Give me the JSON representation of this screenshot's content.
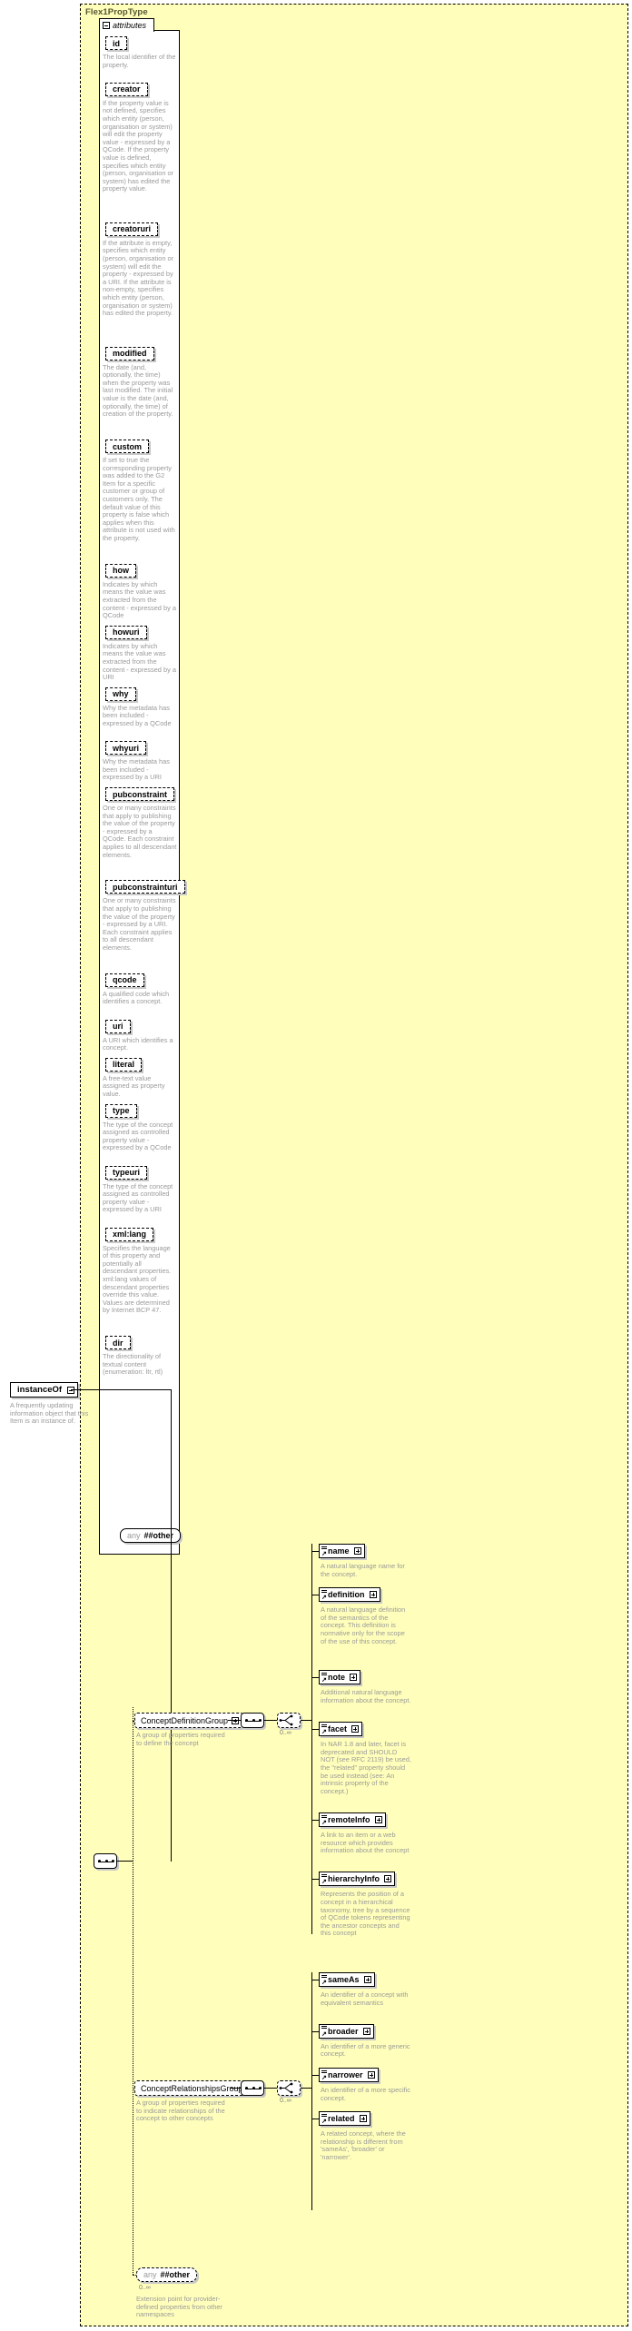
{
  "diagram": {
    "type_name": "Flex1PropType",
    "attributes_label": "attributes",
    "root_element": {
      "name": "instanceOf",
      "description": "A frequently updating information object that this Item is an instance of."
    },
    "attributes": [
      {
        "name": "id",
        "description": "The local identifier of the property."
      },
      {
        "name": "creator",
        "description": "If the property value is not defined, specifies which entity (person, organisation or system) will edit the property value - expressed by a QCode. If the property value is defined, specifies which entity (person, organisation or system) has edited the property value."
      },
      {
        "name": "creatoruri",
        "description": "If the attribute is empty, specifies which entity (person, organisation or system) will edit the property - expressed by a URI. If the attribute is non-empty, specifies which entity (person, organisation or system) has edited the property."
      },
      {
        "name": "modified",
        "description": "The date (and, optionally, the time) when the property was last modified. The initial value is the date (and, optionally, the time) of creation of the property."
      },
      {
        "name": "custom",
        "description": "If set to true the corresponding property was added to the G2 Item for a specific customer or group of customers only. The default value of this property is false which applies when this attribute is not used with the property."
      },
      {
        "name": "how",
        "description": "Indicates by which means the value was extracted from the content - expressed by a QCode"
      },
      {
        "name": "howuri",
        "description": "Indicates by which means the value was extracted from the content - expressed by a URI"
      },
      {
        "name": "why",
        "description": "Why the metadata has been included - expressed by a QCode"
      },
      {
        "name": "whyuri",
        "description": "Why the metadata has been included - expressed by a URI"
      },
      {
        "name": "pubconstraint",
        "description": "One or many constraints that apply to publishing the value of the property - expressed by a QCode. Each constraint applies to all descendant elements."
      },
      {
        "name": "pubconstrainturi",
        "description": "One or many constraints that apply to publishing the value of the property - expressed by a URI. Each constraint applies to all descendant elements."
      },
      {
        "name": "qcode",
        "description": "A qualified code which identifies a concept."
      },
      {
        "name": "uri",
        "description": "A URI which identifies a concept."
      },
      {
        "name": "literal",
        "description": "A free-text value assigned as property value."
      },
      {
        "name": "type",
        "description": "The type of the concept assigned as controlled property value - expressed by a QCode"
      },
      {
        "name": "typeuri",
        "description": "The type of the concept assigned as controlled property value - expressed by a URI"
      },
      {
        "name": "xml:lang",
        "description": "Specifies the language of this property and potentially all descendant properties. xml:lang values of descendant properties override this value. Values are determined by Internet BCP 47."
      },
      {
        "name": "dir",
        "description": "The directionality of textual content (enumeration: ltr, rtl)"
      }
    ],
    "attributes_any": {
      "keyword": "any",
      "value": "##other"
    },
    "groups": [
      {
        "name": "ConceptDefinitionGroup",
        "description": "A group of properties required to define the concept",
        "cardinality": "0..∞",
        "members": [
          {
            "name": "name",
            "description": "A natural language name for the concept."
          },
          {
            "name": "definition",
            "description": "A natural language definition of the semantics of the concept. This definition is normative only for the scope of the use of this concept."
          },
          {
            "name": "note",
            "description": "Additional natural language information about the concept."
          },
          {
            "name": "facet",
            "description": "In NAR 1.8 and later, facet is deprecated and SHOULD NOT (see RFC 2119) be used, the \"related\" property should be used instead (see: An intrinsic property of the concept.)"
          },
          {
            "name": "remoteInfo",
            "description": "A link to an item or a web resource which provides information about the concept"
          },
          {
            "name": "hierarchyInfo",
            "description": "Represents the position of a concept in a hierarchical taxonomy, tree by a sequence of QCode tokens representing the ancestor concepts and this concept"
          }
        ]
      },
      {
        "name": "ConceptRelationshipsGroup",
        "description": "A group of properties required to indicate relationships of the concept to other concepts",
        "cardinality": "0..∞",
        "members": [
          {
            "name": "sameAs",
            "description": "An identifier of a concept with equivalent semantics"
          },
          {
            "name": "broader",
            "description": "An identifier of a more generic concept."
          },
          {
            "name": "narrower",
            "description": "An identifier of a more specific concept."
          },
          {
            "name": "related",
            "description": "A related concept, where the relationship is different from 'sameAs', 'broader' or 'narrower'."
          }
        ]
      }
    ],
    "body_any": {
      "keyword": "any",
      "value": "##other",
      "cardinality": "0..∞",
      "description": "Extension point for provider-defined properties from other namespaces"
    },
    "colors": {
      "type_fill": "#ffffbb",
      "node_fill": "#ffffff",
      "line": "#000000",
      "description_text": "#9a9a9a",
      "title_text": "#555533",
      "shadow": "#c8c8c8"
    }
  }
}
